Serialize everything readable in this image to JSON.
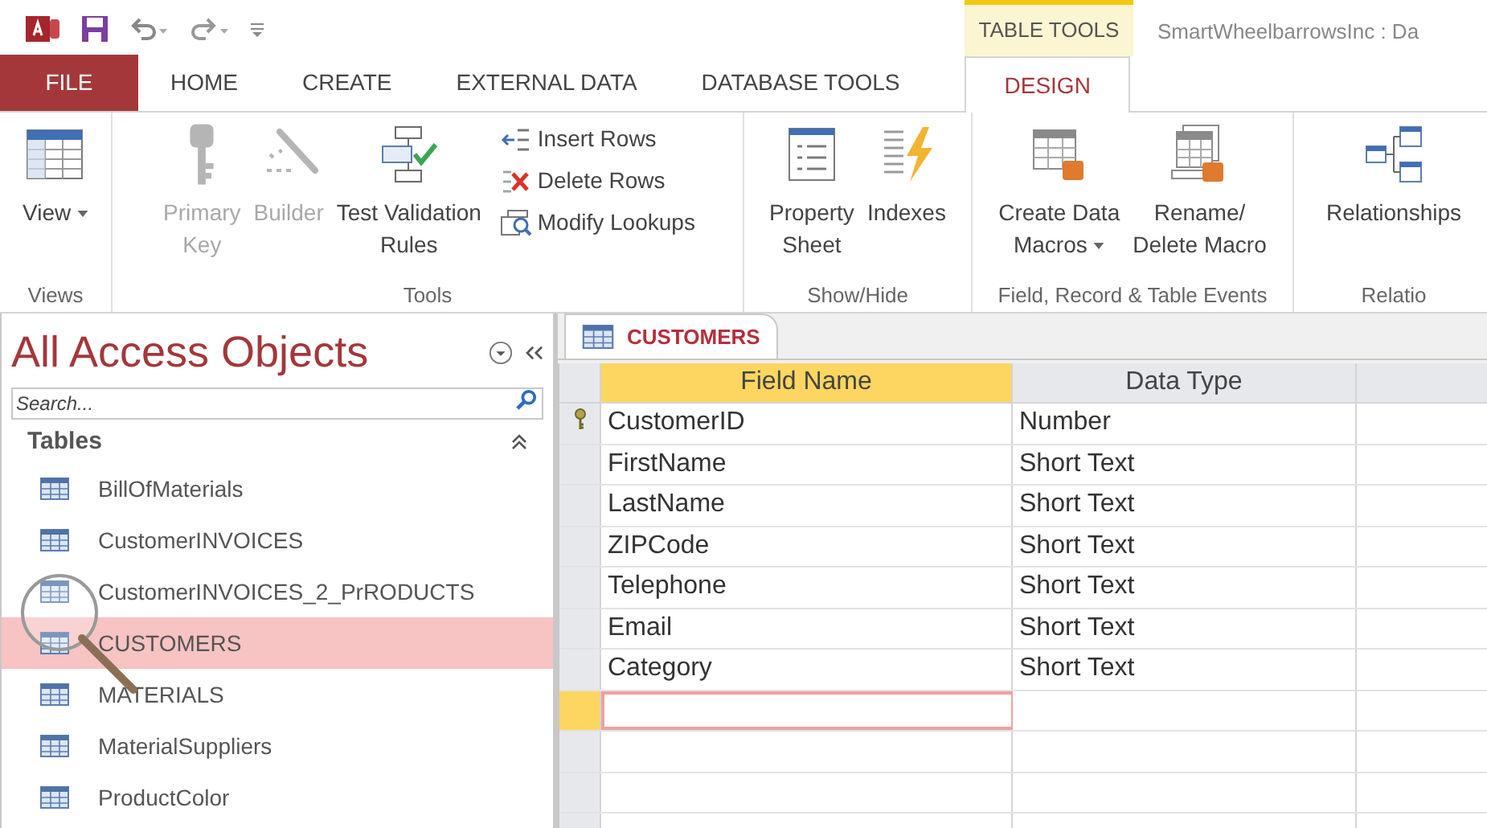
{
  "title_bar": {
    "context_label": "TABLE TOOLS",
    "document_title": "SmartWheelbarrowsInc : Da"
  },
  "menu_tabs": [
    {
      "label": "FILE",
      "kind": "file",
      "selected": false
    },
    {
      "label": "HOME",
      "kind": "tab",
      "selected": false
    },
    {
      "label": "CREATE",
      "kind": "tab",
      "selected": false
    },
    {
      "label": "EXTERNAL DATA",
      "kind": "tab",
      "selected": false
    },
    {
      "label": "DATABASE TOOLS",
      "kind": "tab",
      "selected": false
    },
    {
      "label": "DESIGN",
      "kind": "tab",
      "selected": true
    }
  ],
  "ribbon": {
    "groups": [
      {
        "label": "Views",
        "buttons": [
          {
            "label": "View",
            "kind": "large",
            "disabled": false,
            "dropdown": true
          }
        ]
      },
      {
        "label": "Tools",
        "buttons": [
          {
            "label": "Primary\nKey",
            "kind": "large",
            "disabled": true,
            "dropdown": false
          },
          {
            "label": "Builder",
            "kind": "large",
            "disabled": true,
            "dropdown": false
          },
          {
            "label": "Test Validation\nRules",
            "kind": "large",
            "disabled": false,
            "dropdown": false
          },
          {
            "label": "Insert Rows",
            "kind": "small",
            "disabled": false,
            "dropdown": false
          },
          {
            "label": "Delete Rows",
            "kind": "small",
            "disabled": false,
            "dropdown": false
          },
          {
            "label": "Modify Lookups",
            "kind": "small",
            "disabled": false,
            "dropdown": false
          }
        ]
      },
      {
        "label": "Show/Hide",
        "buttons": [
          {
            "label": "Property\nSheet",
            "kind": "large",
            "disabled": false,
            "dropdown": false
          },
          {
            "label": "Indexes",
            "kind": "large",
            "disabled": false,
            "dropdown": false
          }
        ]
      },
      {
        "label": "Field, Record & Table Events",
        "buttons": [
          {
            "label": "Create Data\nMacros",
            "kind": "large",
            "disabled": false,
            "dropdown": true
          },
          {
            "label": "Rename/\nDelete Macro",
            "kind": "large",
            "disabled": false,
            "dropdown": false
          }
        ]
      },
      {
        "label": "Relatio",
        "buttons": [
          {
            "label": "Relationships",
            "kind": "large",
            "disabled": false,
            "dropdown": false
          }
        ]
      }
    ]
  },
  "navigation_pane": {
    "title": "All Access Objects",
    "search": {
      "placeholder": "Search..."
    },
    "section": {
      "label": "Tables",
      "expanded": true
    },
    "items": [
      {
        "label": "BillOfMaterials",
        "selected": false
      },
      {
        "label": "CustomerINVOICES",
        "selected": false
      },
      {
        "label": "CustomerINVOICES_2_PrRODUCTS",
        "selected": false
      },
      {
        "label": "CUSTOMERS",
        "selected": true
      },
      {
        "label": "MATERIALS",
        "selected": false
      },
      {
        "label": "MaterialSuppliers",
        "selected": false
      },
      {
        "label": "ProductColor",
        "selected": false
      }
    ]
  },
  "document_tab": {
    "label": "CUSTOMERS",
    "selected": true
  },
  "table": {
    "columns": [
      "Field Name",
      "Data Type"
    ],
    "rows": [
      {
        "field_name": "CustomerID",
        "data_type": "Number",
        "primary_key": true,
        "current": false
      },
      {
        "field_name": "FirstName",
        "data_type": "Short Text",
        "primary_key": false,
        "current": false
      },
      {
        "field_name": "LastName",
        "data_type": "Short Text",
        "primary_key": false,
        "current": false
      },
      {
        "field_name": "ZIPCode",
        "data_type": "Short Text",
        "primary_key": false,
        "current": false
      },
      {
        "field_name": "Telephone",
        "data_type": "Short Text",
        "primary_key": false,
        "current": false
      },
      {
        "field_name": "Email",
        "data_type": "Short Text",
        "primary_key": false,
        "current": false
      },
      {
        "field_name": "Category",
        "data_type": "Short Text",
        "primary_key": false,
        "current": false
      },
      {
        "field_name": "",
        "data_type": "",
        "primary_key": false,
        "current": true
      }
    ]
  }
}
